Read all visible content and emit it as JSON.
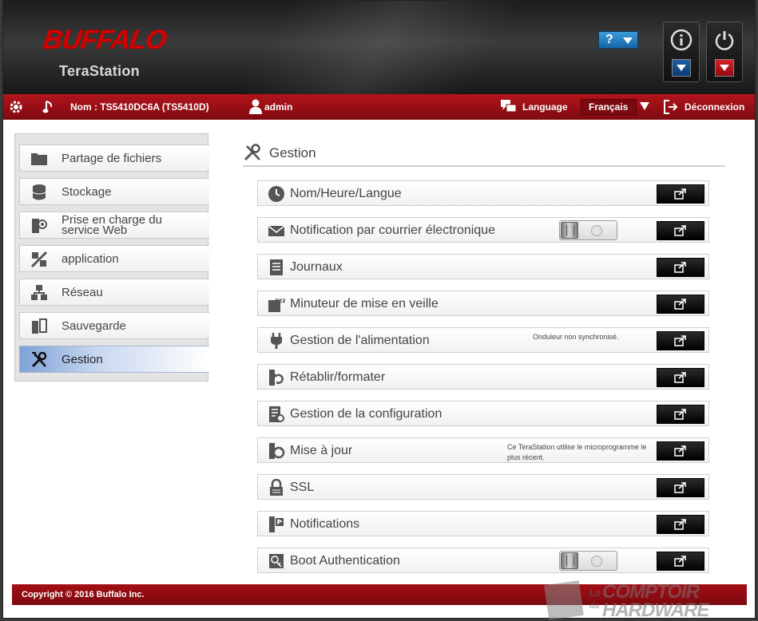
{
  "header": {
    "brand": "BUFFALO",
    "product": "TeraStation",
    "help_label": "?",
    "info_icon": "info-icon",
    "power_icon": "power-icon",
    "accent_blue": "#1466a8",
    "accent_red": "#c8101a"
  },
  "topbar": {
    "name_label": "Nom : TS5410DC6A (TS5410D)",
    "user": "admin",
    "language_label": "Language",
    "language_value": "Français",
    "logout_label": "Déconnexion"
  },
  "sidebar": {
    "items": [
      {
        "label": "Partage de fichiers",
        "icon": "folder-icon"
      },
      {
        "label": "Stockage",
        "icon": "database-icon"
      },
      {
        "label": "Prise en charge du\nservice Web",
        "icon": "web-service-icon"
      },
      {
        "label": "application",
        "icon": "application-icon"
      },
      {
        "label": "Réseau",
        "icon": "network-icon"
      },
      {
        "label": "Sauvegarde",
        "icon": "backup-icon"
      },
      {
        "label": "Gestion",
        "icon": "tools-icon",
        "active": true
      }
    ]
  },
  "main": {
    "title": "Gestion",
    "rows": [
      {
        "label": "Nom/Heure/Langue"
      },
      {
        "label": "Notification par courrier électronique",
        "toggle": "off"
      },
      {
        "label": "Journaux"
      },
      {
        "label": "Minuteur de mise en veille"
      },
      {
        "label": "Gestion de l'alimentation",
        "note": "Onduleur non synchronisé."
      },
      {
        "label": "Rétablir/formater"
      },
      {
        "label": "Gestion de la configuration"
      },
      {
        "label": "Mise à jour",
        "note1": "Ce TeraStation utilise le microprogramme le",
        "note2": "plus récent."
      },
      {
        "label": "SSL"
      },
      {
        "label": "Notifications"
      },
      {
        "label": "Boot Authentication",
        "toggle": "off"
      }
    ]
  },
  "footer": {
    "copyright": "Copyright © 2016 Buffalo Inc."
  },
  "watermark": {
    "le": "Le",
    "du": "du",
    "line1": "COMPTOIR",
    "line2": "HARDWARE"
  }
}
